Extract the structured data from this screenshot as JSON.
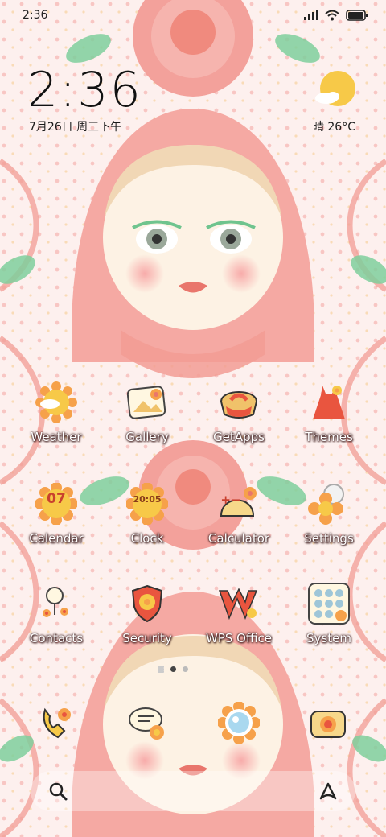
{
  "status_bar": {
    "time": "2:36",
    "icons": [
      "signal-icon",
      "wifi-icon",
      "battery-icon"
    ]
  },
  "clock_widget": {
    "time": "2:36",
    "date": "7月26日 周三下午",
    "weather": "晴 26°C",
    "weather_icon": "sun-cloud-icon"
  },
  "apps": [
    {
      "name": "weather",
      "label": "Weather",
      "icon": "sun-icon"
    },
    {
      "name": "gallery",
      "label": "Gallery",
      "icon": "gallery-icon"
    },
    {
      "name": "getapps",
      "label": "GetApps",
      "icon": "getapps-icon"
    },
    {
      "name": "themes",
      "label": "Themes",
      "icon": "dress-icon"
    },
    {
      "name": "calendar",
      "label": "Calendar",
      "icon": "calendar-icon",
      "icon_text": "07"
    },
    {
      "name": "clock",
      "label": "Clock",
      "icon": "clock-icon",
      "icon_text": "20:05"
    },
    {
      "name": "calculator",
      "label": "Calculator",
      "icon": "calculator-icon",
      "icon_text": "+−"
    },
    {
      "name": "settings",
      "label": "Settings",
      "icon": "gear-flower-icon"
    },
    {
      "name": "contacts",
      "label": "Contacts",
      "icon": "contacts-icon"
    },
    {
      "name": "security",
      "label": "Security",
      "icon": "shield-icon"
    },
    {
      "name": "wps-office",
      "label": "WPS Office",
      "icon": "wps-icon",
      "icon_text": "W"
    },
    {
      "name": "system",
      "label": "System",
      "icon": "folder-grid-icon"
    }
  ],
  "dock_apps": [
    "phone-icon",
    "messages-icon",
    "browser-icon",
    "camera-icon"
  ],
  "pager": {
    "pages": 2,
    "current": 1
  },
  "dock_bar": {
    "left_icon": "search-icon",
    "right_icon": "assistant-icon"
  },
  "colors": {
    "accent": "#f08a7e",
    "pink": "#f4a3a0",
    "green": "#6fc48e",
    "yellow": "#f7c948",
    "label": "#ffffff"
  }
}
